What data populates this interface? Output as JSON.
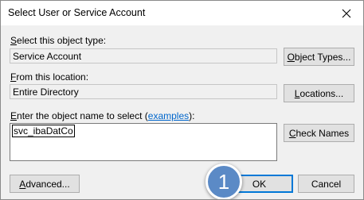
{
  "window": {
    "title": "Select User or Service Account",
    "close_icon": "close-icon"
  },
  "object_type": {
    "label_prefix": "",
    "label_u": "S",
    "label_rest": "elect this object type:",
    "value": "Service Account",
    "button_u": "O",
    "button_rest": "bject Types..."
  },
  "location": {
    "label_u": "F",
    "label_rest": "rom this location:",
    "value": "Entire Directory",
    "button_u": "L",
    "button_rest": "ocations..."
  },
  "object_name": {
    "label_u": "E",
    "label_rest": "nter the object name to select (",
    "link": "examples",
    "label_end": "):",
    "value": "svc_ibaDatCo",
    "check_u": "C",
    "check_rest": "heck Names"
  },
  "footer": {
    "advanced_u": "A",
    "advanced_rest": "dvanced...",
    "ok_label": "OK",
    "cancel_label": "Cancel"
  },
  "annotation": {
    "step_number": "1",
    "color": "#5b8ac6"
  }
}
